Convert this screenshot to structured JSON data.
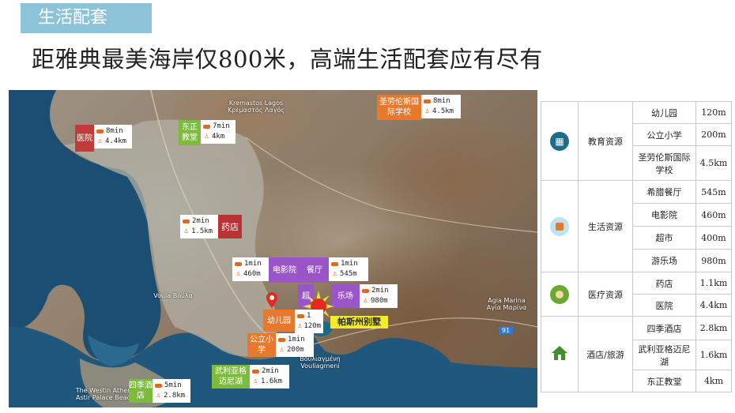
{
  "header": {
    "section_title": "生活配套"
  },
  "headline": "距雅典最美海岸仅800米，高端生活配套应有尽有",
  "map": {
    "place_labels": [
      {
        "text": "Kremastos Lagos Κρεμαστός Λαγός",
        "id": "kremastos"
      },
      {
        "text": "Voula Βούλα",
        "id": "voula"
      },
      {
        "text": "Βουλιαγμένη Vouliagmeni",
        "id": "vouliagmeni"
      },
      {
        "text": "Agia Marina Αγία Μαρίνα",
        "id": "agia-marina"
      },
      {
        "text": "The Westin Athens Astir Palace Beach",
        "id": "westin"
      }
    ],
    "pois": [
      {
        "id": "hospital",
        "label": "医院",
        "color": "#c23a3a",
        "car": "8min",
        "walk": "4.4km"
      },
      {
        "id": "church",
        "label": "东正教堂",
        "color": "#7dbb3c",
        "car": "7min",
        "walk": "4km"
      },
      {
        "id": "school-stlawrence",
        "label": "圣劳伦斯国际学校",
        "color": "#e8792c",
        "car": "8min",
        "walk": "4.5km"
      },
      {
        "id": "pharmacy",
        "label": "药店",
        "color": "#b83333",
        "car": "2min",
        "walk": "1.5km"
      },
      {
        "id": "cinema",
        "label": "电影院",
        "color": "#9a55c8",
        "car": "1min",
        "walk": "460m"
      },
      {
        "id": "restaurant",
        "label": "餐厅",
        "color": "#9a55c8",
        "car": "1min",
        "walk": "545m"
      },
      {
        "id": "supermarket",
        "label": "超",
        "color": "#9a55c8"
      },
      {
        "id": "amusement",
        "label": "乐场",
        "color": "#9a55c8",
        "car": "2min",
        "walk": "980m"
      },
      {
        "id": "kindergarten",
        "label": "幼儿园",
        "color": "#e8792c",
        "car": "1",
        "walk": "120m"
      },
      {
        "id": "primary",
        "label": "公立小学",
        "color": "#e8792c",
        "car": "1min",
        "walk": "200m"
      },
      {
        "id": "lake",
        "label": "武利亚格迈尼湖",
        "color": "#7dbb3c",
        "car": "2min",
        "walk": "1.6km"
      },
      {
        "id": "hotel",
        "label": "四季酒店",
        "color": "#7dbb3c",
        "car": "5min",
        "walk": "2.8km"
      }
    ],
    "villa_label": "帕斯州别墅",
    "road_number": "91"
  },
  "table": {
    "groups": [
      {
        "category": "教育资源",
        "icon": "school-icon",
        "icon_color": "#1e6d8c",
        "rows": [
          {
            "name": "幼儿园",
            "dist": "120m"
          },
          {
            "name": "公立小学",
            "dist": "200m"
          },
          {
            "name": "圣劳伦斯国际学校",
            "dist": "4.5km"
          }
        ]
      },
      {
        "category": "生活资源",
        "icon": "shopping-bag-icon",
        "icon_color": "#6fb7da",
        "rows": [
          {
            "name": "希腊餐厅",
            "dist": "545m"
          },
          {
            "name": "电影院",
            "dist": "460m"
          },
          {
            "name": "超市",
            "dist": "400m"
          },
          {
            "name": "游乐场",
            "dist": "980m"
          }
        ]
      },
      {
        "category": "医疗资源",
        "icon": "doctor-icon",
        "icon_color": "#6aaa2e",
        "rows": [
          {
            "name": "药店",
            "dist": "1.1km"
          },
          {
            "name": "医院",
            "dist": "4.4km"
          }
        ]
      },
      {
        "category": "酒店/旅游",
        "icon": "house-icon",
        "icon_color": "#3f8f2a",
        "rows": [
          {
            "name": "四季酒店",
            "dist": "2.8km"
          },
          {
            "name": "武利亚格迈尼湖",
            "dist": "1.6km"
          },
          {
            "name": "东正教堂",
            "dist": "4km"
          }
        ]
      }
    ]
  }
}
